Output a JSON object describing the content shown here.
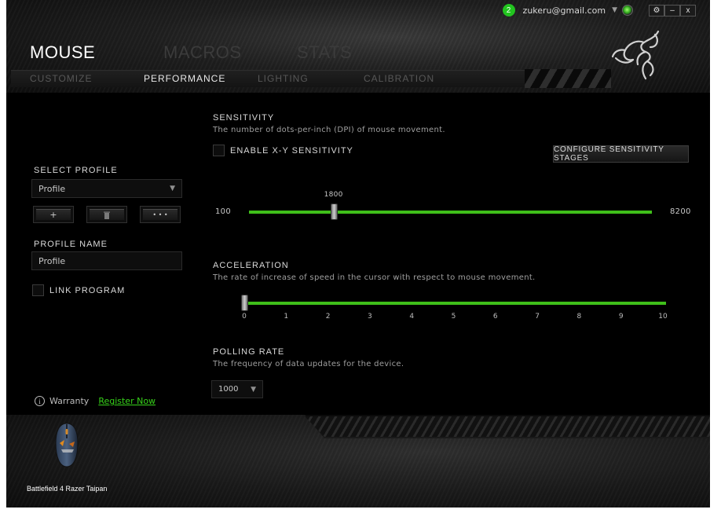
{
  "titlebar": {
    "notification_count": "2",
    "account_email": "zukeru@gmail.com",
    "settings_label": "⚙",
    "minimize_label": "–",
    "close_label": "x"
  },
  "main_tabs": [
    "MOUSE",
    "MACROS",
    "STATS"
  ],
  "sub_tabs": [
    "CUSTOMIZE",
    "PERFORMANCE",
    "LIGHTING",
    "CALIBRATION"
  ],
  "profile": {
    "select_label": "SELECT PROFILE",
    "selected": "Profile",
    "add_label": "+",
    "delete_label": "🗑",
    "more_label": "• • •",
    "name_label": "PROFILE NAME",
    "name_value": "Profile",
    "link_program_label": "LINK PROGRAM"
  },
  "sensitivity": {
    "title": "SENSITIVITY",
    "description": "The number of dots-per-inch (DPI) of mouse movement.",
    "enable_xy_label": "ENABLE X-Y SENSITIVITY",
    "configure_label": "CONFIGURE SENSITIVITY STAGES",
    "min": "100",
    "max": "8200",
    "value": "1800",
    "min_num": 100,
    "max_num": 8200,
    "value_num": 1800
  },
  "acceleration": {
    "title": "ACCELERATION",
    "description": "The rate of increase of speed in the cursor with respect to mouse movement.",
    "ticks": [
      "0",
      "1",
      "2",
      "3",
      "4",
      "5",
      "6",
      "7",
      "8",
      "9",
      "10"
    ],
    "value": 0
  },
  "polling": {
    "title": "POLLING RATE",
    "description": "The frequency of data updates for the device.",
    "selected": "1000"
  },
  "warranty": {
    "label": "Warranty",
    "register_label": "Register Now"
  },
  "device": {
    "name": "Battlefield 4 Razer Taipan"
  },
  "colors": {
    "accent_green": "#3fbf1a",
    "link_green": "#37d21a"
  }
}
